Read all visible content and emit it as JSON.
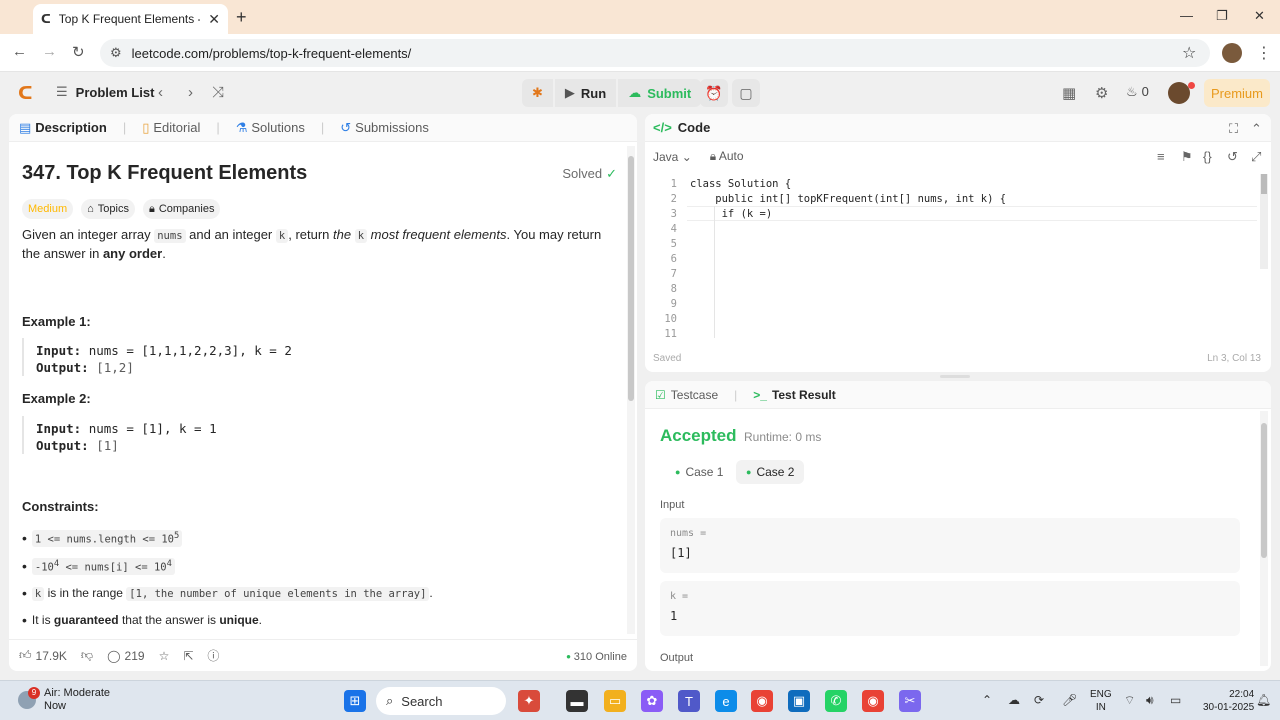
{
  "browser": {
    "tab_title": "Top K Frequent Elements - Leet",
    "url": "leetcode.com/problems/top-k-frequent-elements/"
  },
  "header": {
    "problem_list": "Problem List",
    "run": "Run",
    "submit": "Submit",
    "streak": "0",
    "premium": "Premium"
  },
  "left": {
    "tabs": [
      "Description",
      "Editorial",
      "Solutions",
      "Submissions"
    ],
    "title": "347. Top K Frequent Elements",
    "solved": "Solved",
    "tags": [
      "Medium",
      "Topics",
      "Companies"
    ],
    "desc": {
      "p1": "Given an integer array ",
      "c1": "nums",
      "p2": " and an integer ",
      "c2": "k",
      "p3": ", return ",
      "p3i": "the ",
      "c3": "k",
      "p4i": " most frequent elements",
      "p5": ". You may return the answer in ",
      "p6b": "any order",
      "p7": "."
    },
    "example1": {
      "heading": "Example 1:",
      "input_label": "Input:",
      "input_value": "nums = [1,1,1,2,2,3], k = 2",
      "output_label": "Output:",
      "output_value": "[1,2]"
    },
    "example2": {
      "heading": "Example 2:",
      "input_label": "Input:",
      "input_value": "nums = [1], k = 1",
      "output_label": "Output:",
      "output_value": "[1]"
    },
    "constraints_heading": "Constraints:",
    "constraints": {
      "c1_a": "1 <= nums.length <= 10",
      "c1_sup": "5",
      "c2_a": "-10",
      "c2_sup1": "4",
      "c2_b": " <= nums[i] <= 10",
      "c2_sup2": "4",
      "c3_code": "k",
      "c3_text": " is in the range ",
      "c3_range": "[1, the number of unique elements in the array]",
      "c3_end": ".",
      "c4_a": "It is ",
      "c4_b": "guaranteed",
      "c4_c": " that the answer is ",
      "c4_d": "unique",
      "c4_e": "."
    },
    "footer": {
      "likes": "17.9K",
      "comments": "219",
      "online": "310 Online"
    }
  },
  "code": {
    "title": "Code",
    "language": "Java",
    "mode": "Auto",
    "lines": [
      "class Solution {",
      "    public int[] topKFrequent(int[] nums, int k) {",
      "     if (k =)",
      "",
      "",
      "",
      "",
      "",
      "",
      "",
      ""
    ],
    "line_numbers": [
      "1",
      "2",
      "3",
      "4",
      "5",
      "6",
      "7",
      "8",
      "9",
      "10",
      "11"
    ],
    "status": "Saved",
    "cursor": "Ln 3, Col 13"
  },
  "test": {
    "tabs": [
      "Testcase",
      "Test Result"
    ],
    "verdict": "Accepted",
    "runtime": "Runtime: 0 ms",
    "cases": [
      "Case 1",
      "Case 2"
    ],
    "input_label": "Input",
    "inputs": [
      {
        "name": "nums =",
        "value": "[1]"
      },
      {
        "name": "k =",
        "value": "1"
      }
    ],
    "output_label": "Output"
  },
  "taskbar": {
    "weather_title": "Air: Moderate",
    "weather_sub": "Now",
    "weather_badge": "9",
    "search": "Search",
    "lang1": "ENG",
    "lang2": "IN",
    "time": "22:04",
    "date": "30-01-2025"
  },
  "colors": {
    "accent_green": "#2cbb5d",
    "medium": "#ffb800",
    "premium": "#e89a1d"
  }
}
